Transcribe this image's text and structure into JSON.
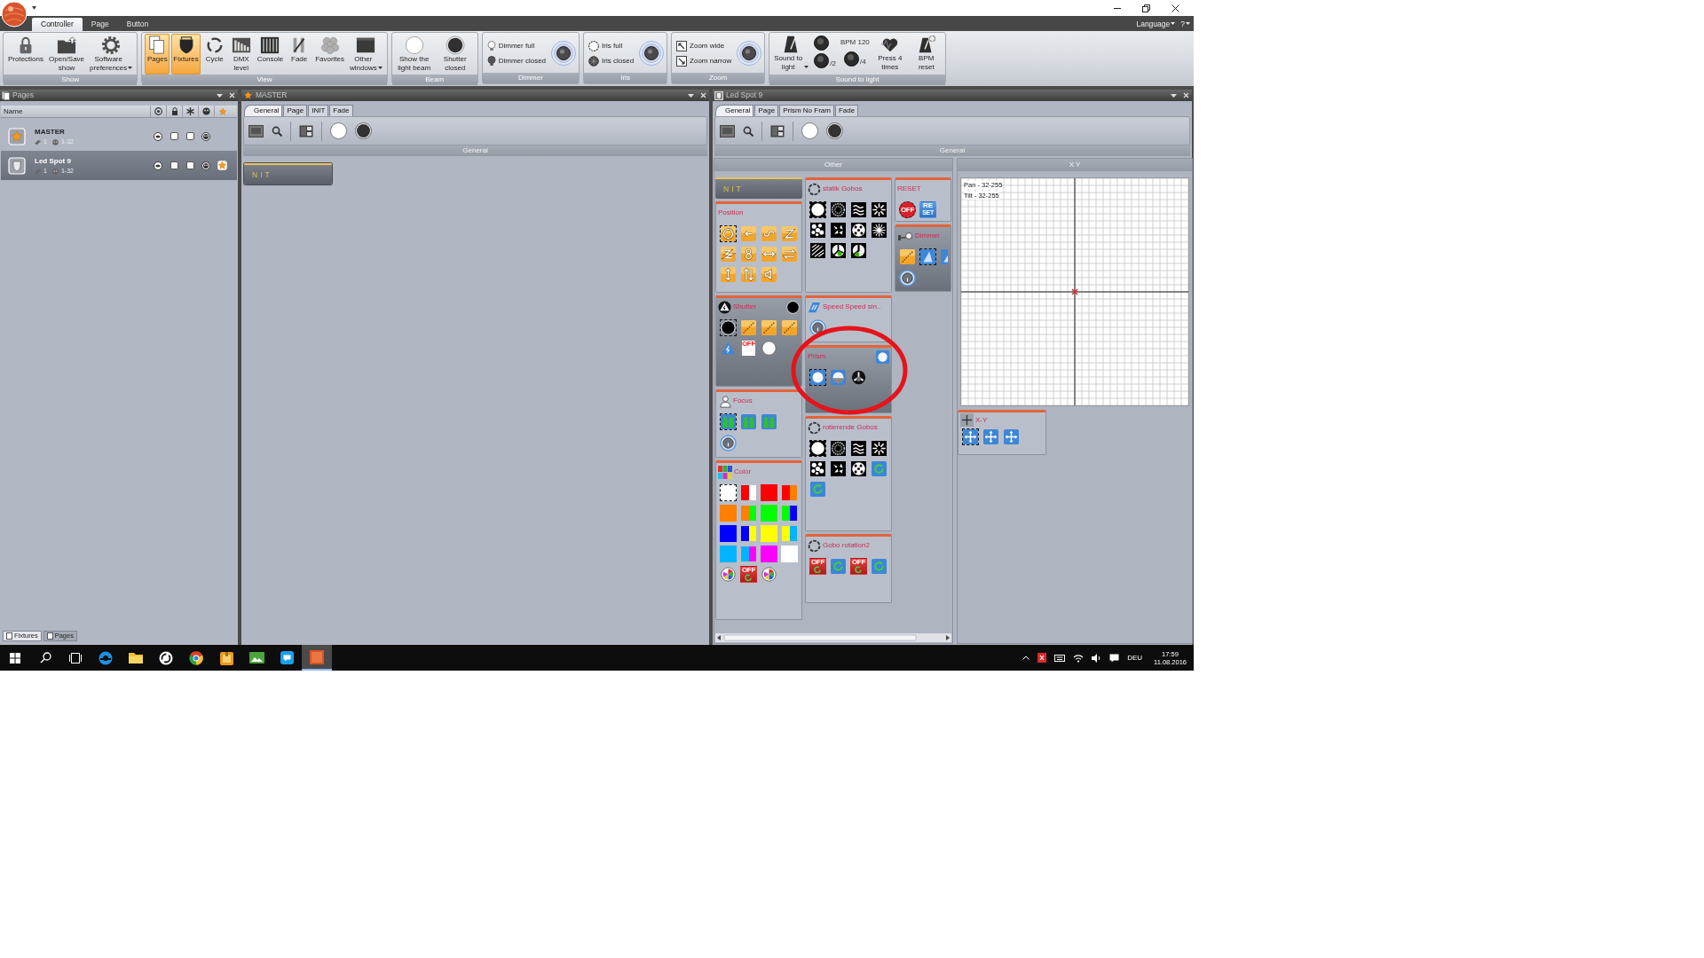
{
  "ribbon": {
    "tabs": [
      {
        "label": "Controller",
        "selected": true
      },
      {
        "label": "Page",
        "selected": false
      },
      {
        "label": "Button",
        "selected": false
      }
    ],
    "language_menu": "Language",
    "help_menu": "?",
    "groups": [
      {
        "title": "Show",
        "kind": "large",
        "buttons": [
          {
            "label": "Protections",
            "kind": "lock",
            "selected": false,
            "dropdown": false
          },
          {
            "label": "Open/Save show",
            "kind": "folder",
            "selected": false,
            "dropdown": false
          },
          {
            "label": "Software preferences",
            "kind": "gear",
            "selected": false,
            "dropdown": true
          }
        ]
      },
      {
        "title": "View",
        "kind": "large",
        "buttons": [
          {
            "label": "Pages",
            "kind": "pages",
            "selected": true,
            "dropdown": false
          },
          {
            "label": "Fixtures",
            "kind": "fixture",
            "selected": true,
            "dropdown": false
          },
          {
            "label": "Cycle",
            "kind": "cycle",
            "selected": false,
            "dropdown": false
          },
          {
            "label": "DMX level",
            "kind": "dmx",
            "selected": false,
            "dropdown": false
          },
          {
            "label": "Console",
            "kind": "console",
            "selected": false,
            "dropdown": false
          },
          {
            "label": "Fade",
            "kind": "fade",
            "selected": false,
            "dropdown": false
          },
          {
            "label": "Favorites",
            "kind": "favorites",
            "selected": false,
            "dropdown": false
          },
          {
            "label": "Other windows",
            "kind": "window",
            "selected": false,
            "dropdown": true
          }
        ]
      },
      {
        "title": "Beam",
        "kind": "large",
        "buttons": [
          {
            "label": "Show the light beam",
            "kind": "white-disc",
            "selected": false,
            "dropdown": false
          },
          {
            "label": "Shutter closed",
            "kind": "black-disc",
            "selected": false,
            "dropdown": false
          }
        ]
      },
      {
        "title": "Dimmer",
        "kind": "knob",
        "items": [
          {
            "label": "Dimmer full",
            "kind": "bulb-on"
          },
          {
            "label": "Dimmer closed",
            "kind": "bulb-off"
          }
        ]
      },
      {
        "title": "Iris",
        "kind": "knob",
        "items": [
          {
            "label": "Iris full",
            "kind": "iris-open"
          },
          {
            "label": "Iris closed",
            "kind": "iris-closed"
          }
        ]
      },
      {
        "title": "Zoom",
        "kind": "knob",
        "items": [
          {
            "label": "Zoom wide",
            "kind": "zoom-wide"
          },
          {
            "label": "Zoom narrow",
            "kind": "zoom-narrow"
          }
        ]
      },
      {
        "title": "Sound to light",
        "kind": "sound",
        "main": {
          "label": "Sound to light",
          "dropdown": true
        },
        "bpm": "BPM 120",
        "half": "/2",
        "quarter": "/4",
        "tap": "Press 4 times",
        "reset": "BPM reset"
      }
    ]
  },
  "pages_panel": {
    "title": "Pages",
    "column_name": "Name",
    "rows": [
      {
        "name": "MASTER",
        "kind": "master",
        "count": "1",
        "range": "1-32",
        "selected": false,
        "locked": false,
        "frozen": false,
        "favorite": false
      },
      {
        "name": "Led Spot 9",
        "kind": "fixture",
        "count": "1",
        "range": "1-32",
        "selected": true,
        "locked": false,
        "frozen": false,
        "favorite": true
      }
    ],
    "tabs": [
      {
        "label": "Fixtures",
        "selected": true
      },
      {
        "label": "Pages",
        "selected": false
      }
    ]
  },
  "master_panel": {
    "title": "MASTER",
    "tabs": [
      {
        "label": "General",
        "selected": true
      },
      {
        "label": "Page",
        "selected": false
      },
      {
        "label": "INIT",
        "selected": false
      },
      {
        "label": "Fade",
        "selected": false
      }
    ],
    "section": "General",
    "buttons": [
      {
        "label": "NIT"
      }
    ]
  },
  "fixture_panel": {
    "title": "Led Spot 9",
    "tabs": [
      {
        "label": "General",
        "selected": true
      },
      {
        "label": "Page",
        "selected": false
      },
      {
        "label": "Prism No Fram",
        "selected": false
      },
      {
        "label": "Fade",
        "selected": false
      }
    ],
    "section": "General",
    "other": {
      "title": "Other",
      "columns": [
        {
          "cards": [
            {
              "kind": "button",
              "label": "NIT"
            },
            {
              "kind": "position",
              "title": "Position",
              "active": false,
              "items": [
                {
                  "kind": "path",
                  "selected": true
                },
                {
                  "kind": "path",
                  "selected": false
                },
                {
                  "kind": "path",
                  "selected": false
                },
                {
                  "kind": "path",
                  "selected": false
                },
                {
                  "kind": "path",
                  "selected": false
                },
                {
                  "kind": "path",
                  "selected": false
                },
                {
                  "kind": "path",
                  "selected": false
                },
                {
                  "kind": "path",
                  "selected": false
                },
                {
                  "kind": "path",
                  "selected": false
                },
                {
                  "kind": "path",
                  "selected": false
                },
                {
                  "kind": "path",
                  "selected": false
                }
              ]
            },
            {
              "kind": "shutter",
              "title": "Shutter",
              "active": true,
              "items": [
                {
                  "kind": "black-disc",
                  "selected": true
                },
                {
                  "kind": "ramp",
                  "selected": false
                },
                {
                  "kind": "ramp",
                  "selected": false
                },
                {
                  "kind": "ramp",
                  "selected": false
                },
                {
                  "kind": "strobe",
                  "selected": false
                },
                {
                  "kind": "strobe-off",
                  "label": "OFF",
                  "selected": false
                },
                {
                  "kind": "white-disc",
                  "selected": false
                }
              ]
            },
            {
              "kind": "focus",
              "title": "Focus",
              "active": false,
              "knob": true,
              "items": [
                {
                  "kind": "person",
                  "selected": true
                },
                {
                  "kind": "person",
                  "selected": false
                },
                {
                  "kind": "person",
                  "selected": false
                }
              ]
            },
            {
              "kind": "color",
              "title": "Color",
              "active": false,
              "items": [
                {
                  "kind": "swatch",
                  "color": "#ffffff",
                  "selected": true
                },
                {
                  "kind": "split-swatch",
                  "halves": [
                    {
                      "color": "#ff0000"
                    },
                    {
                      "color": "#ffffff"
                    }
                  ],
                  "selected": false
                },
                {
                  "kind": "swatch",
                  "color": "#ff0000",
                  "selected": false
                },
                {
                  "kind": "split-swatch",
                  "halves": [
                    {
                      "color": "#ff0000"
                    },
                    {
                      "color": "#ff7f00"
                    }
                  ],
                  "selected": false
                },
                {
                  "kind": "swatch",
                  "color": "#ff7f00",
                  "selected": false
                },
                {
                  "kind": "split-swatch",
                  "halves": [
                    {
                      "color": "#ff7f00"
                    },
                    {
                      "color": "#00ff00"
                    }
                  ],
                  "selected": false
                },
                {
                  "kind": "swatch",
                  "color": "#00ff00",
                  "selected": false
                },
                {
                  "kind": "split-swatch",
                  "halves": [
                    {
                      "color": "#00ff00"
                    },
                    {
                      "color": "#0000ff"
                    }
                  ],
                  "selected": false
                },
                {
                  "kind": "swatch",
                  "color": "#0000ff",
                  "selected": false
                },
                {
                  "kind": "split-swatch",
                  "halves": [
                    {
                      "color": "#0000ff"
                    },
                    {
                      "color": "#ffff00"
                    }
                  ],
                  "selected": false
                },
                {
                  "kind": "swatch",
                  "color": "#ffff00",
                  "selected": false
                },
                {
                  "kind": "split-swatch",
                  "halves": [
                    {
                      "color": "#ffff00"
                    },
                    {
                      "color": "#00b4ff"
                    }
                  ],
                  "selected": false
                },
                {
                  "kind": "swatch",
                  "color": "#00b4ff",
                  "selected": false
                },
                {
                  "kind": "split-swatch",
                  "halves": [
                    {
                      "color": "#00b4ff"
                    },
                    {
                      "color": "#ff00ff"
                    }
                  ],
                  "selected": false
                },
                {
                  "kind": "swatch",
                  "color": "#ff00ff",
                  "selected": false
                },
                {
                  "kind": "swatch",
                  "color": "#ffffff",
                  "selected": false
                },
                {
                  "kind": "wheel",
                  "selected": false
                },
                {
                  "kind": "off-tile",
                  "label": "OFF",
                  "selected": false
                },
                {
                  "kind": "wheel",
                  "selected": false
                }
              ]
            }
          ]
        },
        {
          "cards": [
            {
              "kind": "static-gobos",
              "title": "statik Gobos",
              "active": false,
              "items": [
                {
                  "kind": "open",
                  "selected": true
                },
                {
                  "kind": "gobo",
                  "selected": false
                },
                {
                  "kind": "gobo",
                  "selected": false
                },
                {
                  "kind": "gobo",
                  "selected": false
                },
                {
                  "kind": "gobo",
                  "selected": false
                },
                {
                  "kind": "gobo",
                  "selected": false
                },
                {
                  "kind": "gobo",
                  "selected": false
                },
                {
                  "kind": "gobo",
                  "selected": false
                },
                {
                  "kind": "gobo",
                  "selected": false
                },
                {
                  "kind": "gobo",
                  "selected": false
                },
                {
                  "kind": "gobo",
                  "selected": false
                }
              ]
            },
            {
              "kind": "speed",
              "title": "Speed Speed sin..",
              "active": false,
              "knob": true
            },
            {
              "kind": "prism",
              "title": "Prism",
              "active": true,
              "items": [
                {
                  "kind": "prism-full",
                  "selected": true
                },
                {
                  "kind": "prism-half",
                  "selected": false
                },
                {
                  "kind": "prism-dark",
                  "selected": false
                }
              ]
            },
            {
              "kind": "rotating-gobos",
              "title": "rotierende Gobos",
              "active": false,
              "items": [
                {
                  "kind": "open",
                  "selected": true
                },
                {
                  "kind": "gobo",
                  "selected": false
                },
                {
                  "kind": "gobo",
                  "selected": false
                },
                {
                  "kind": "gobo",
                  "selected": false
                },
                {
                  "kind": "gobo",
                  "selected": false
                },
                {
                  "kind": "gobo",
                  "selected": false
                },
                {
                  "kind": "gobo",
                  "selected": false
                },
                {
                  "kind": "rotate",
                  "selected": false
                },
                {
                  "kind": "rotate",
                  "selected": false
                }
              ]
            },
            {
              "kind": "gobo-rotation",
              "title": "Gobo rotation2",
              "active": false,
              "items": [
                {
                  "kind": "off-tile",
                  "label": "OFF",
                  "selected": false
                },
                {
                  "kind": "rotate",
                  "selected": false
                },
                {
                  "kind": "off-tile",
                  "label": "OFF",
                  "selected": false
                },
                {
                  "kind": "rotate",
                  "selected": false
                }
              ]
            }
          ]
        },
        {
          "cards": [
            {
              "kind": "reset",
              "title": "RESET",
              "active": false,
              "items": [
                {
                  "kind": "off-disc",
                  "label": "OFF",
                  "selected": true
                },
                {
                  "kind": "reset",
                  "label": "RE",
                  "sublabel": "SET",
                  "selected": false
                }
              ]
            },
            {
              "kind": "dimmer",
              "title": "Dimmer",
              "active": true,
              "knob": true,
              "items": [
                {
                  "kind": "ramp",
                  "selected": false
                },
                {
                  "kind": "beam",
                  "selected": true
                },
                {
                  "kind": "beam",
                  "selected": false
                }
              ]
            }
          ]
        }
      ]
    },
    "xy": {
      "title": "X Y",
      "pan": "Pan - 32-255",
      "tilt": "Tilt - 32-255",
      "card": {
        "title": "X-Y",
        "items": [
          {
            "kind": "arrows",
            "selected": true
          },
          {
            "kind": "arrows",
            "selected": false
          },
          {
            "kind": "arrows",
            "selected": false
          }
        ]
      }
    }
  },
  "taskbar": {
    "apps": [
      {
        "kind": "start",
        "active": false
      },
      {
        "kind": "search",
        "active": false
      },
      {
        "kind": "task-view",
        "active": false
      },
      {
        "kind": "edge",
        "active": false
      },
      {
        "kind": "explorer",
        "active": false
      },
      {
        "kind": "sync",
        "active": false
      },
      {
        "kind": "chrome",
        "active": false
      },
      {
        "kind": "package",
        "active": false
      },
      {
        "kind": "photos",
        "active": false
      },
      {
        "kind": "skype",
        "active": false
      },
      {
        "kind": "app",
        "active": true
      }
    ],
    "language": "DEU",
    "time": "17:59",
    "date": "11.08.2016"
  }
}
